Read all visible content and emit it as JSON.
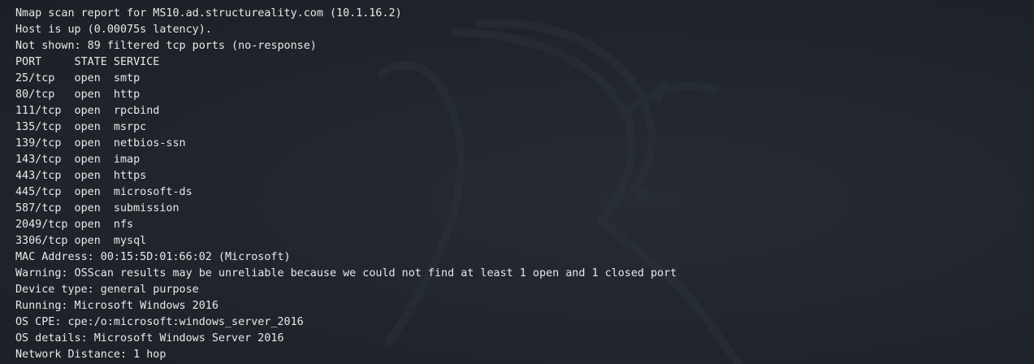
{
  "terminal": {
    "lines": [
      "Nmap scan report for MS10.ad.structureality.com (10.1.16.2)",
      "Host is up (0.00075s latency).",
      "Not shown: 89 filtered tcp ports (no-response)",
      "PORT     STATE SERVICE",
      "25/tcp   open  smtp",
      "80/tcp   open  http",
      "111/tcp  open  rpcbind",
      "135/tcp  open  msrpc",
      "139/tcp  open  netbios-ssn",
      "143/tcp  open  imap",
      "443/tcp  open  https",
      "445/tcp  open  microsoft-ds",
      "587/tcp  open  submission",
      "2049/tcp open  nfs",
      "3306/tcp open  mysql",
      "MAC Address: 00:15:5D:01:66:02 (Microsoft)",
      "Warning: OSScan results may be unreliable because we could not find at least 1 open and 1 closed port",
      "Device type: general purpose",
      "Running: Microsoft Windows 2016",
      "OS CPE: cpe:/o:microsoft:windows_server_2016",
      "OS details: Microsoft Windows Server 2016",
      "Network Distance: 1 hop"
    ]
  },
  "colors": {
    "background": "#20242b",
    "text": "#e8e8e8",
    "watermark": "#2b313a"
  },
  "icons": {
    "watermark": "kali-dragon-icon"
  }
}
